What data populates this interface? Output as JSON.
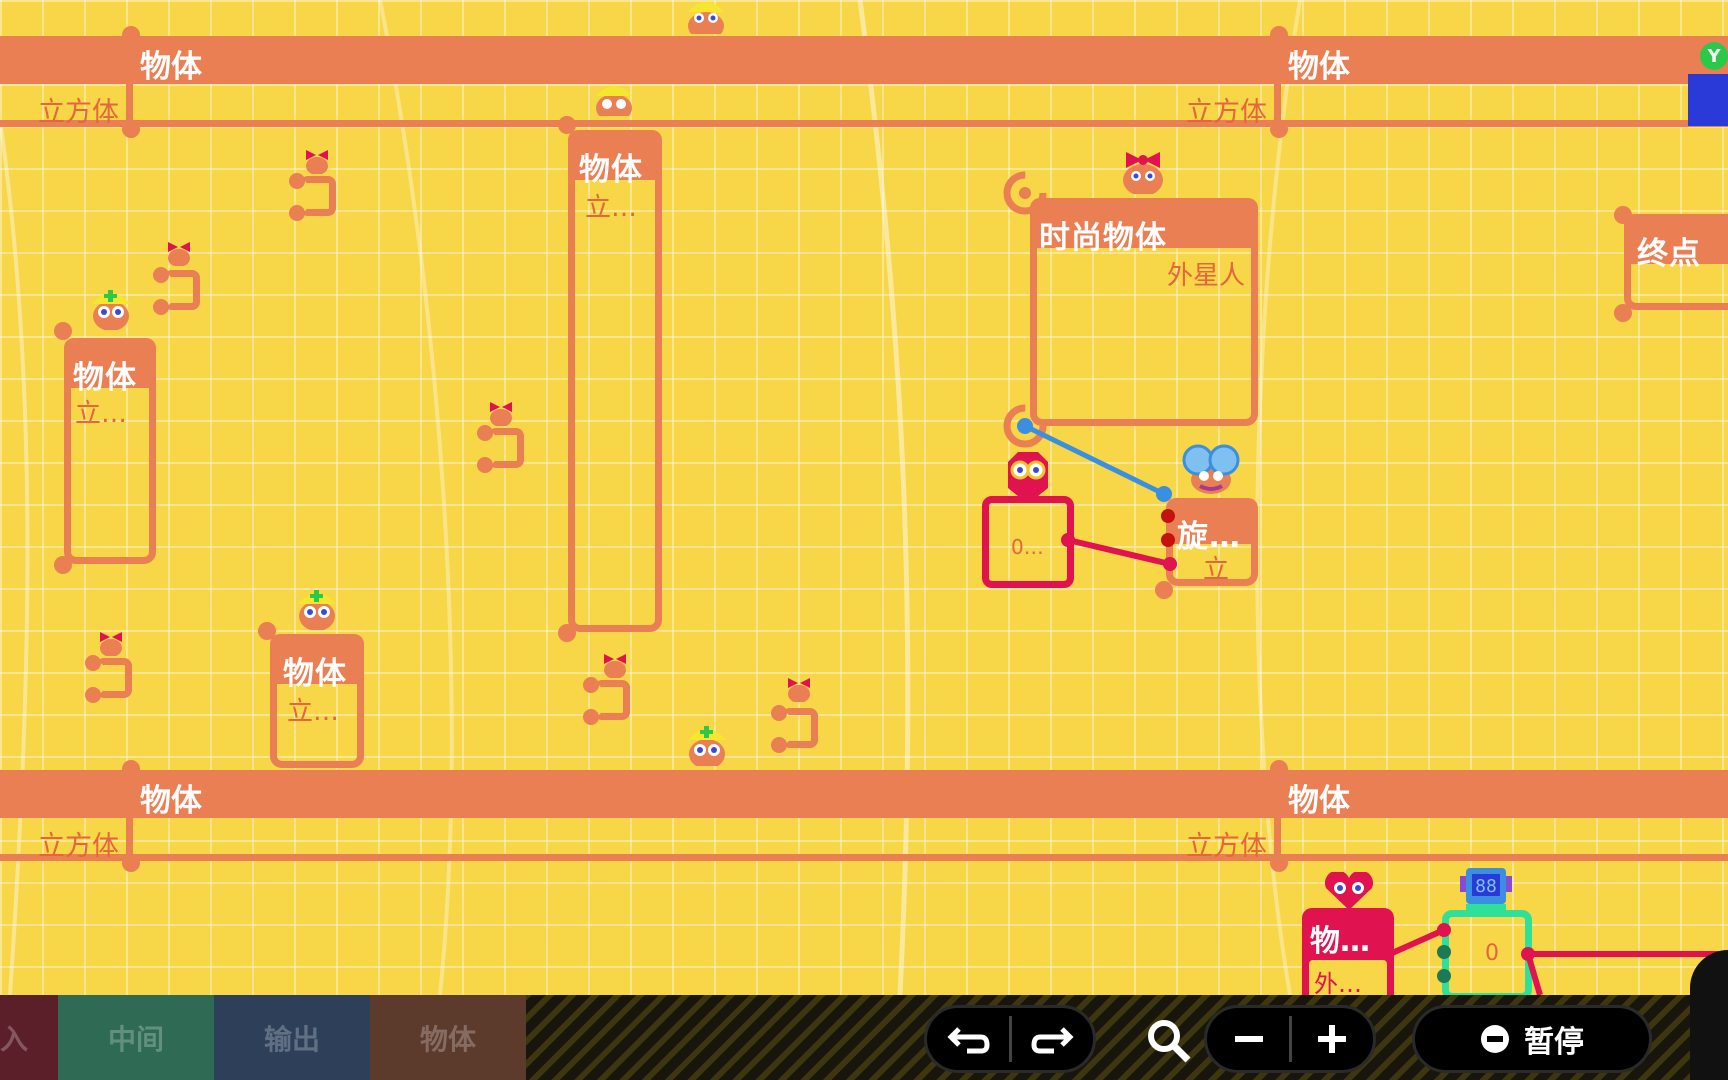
{
  "nodes": {
    "band_top_left_title": "物体",
    "band_top_left_sub": "立方体",
    "band_top_mid_sub": "立方体",
    "band_top_right_title": "物体",
    "band_bottom_left_title": "物体",
    "band_bottom_left_sub": "立方体",
    "band_bottom_mid_sub": "立方体",
    "band_bottom_right_title": "物体",
    "left_object_title": "物体",
    "left_object_sub": "立…",
    "tall_object_title": "物体",
    "tall_object_sub": "立…",
    "small_object_title": "物体",
    "small_object_sub": "立…",
    "fancy_object_title": "时尚物体",
    "fancy_object_sub": "外星人",
    "endpoint_title": "终点",
    "counter_value": "0…",
    "rotate_title": "旋…",
    "rotate_sub": "立",
    "alien_object_title": "物…",
    "alien_object_sub": "外…",
    "display_value": "0"
  },
  "toolbar": {
    "tabs": [
      {
        "label": "入",
        "color": "#5b1f2a"
      },
      {
        "label": "中间",
        "color": "#2f6a54"
      },
      {
        "label": "输出",
        "color": "#2d3f59"
      },
      {
        "label": "物体",
        "color": "#5c3a2c"
      }
    ],
    "pause_label": "暂停",
    "colors": {
      "wire_blue": "#3a8fe0",
      "wire_pink": "#e0128f",
      "node_orange": "#e97f53",
      "node_red": "#e0124f",
      "bg_yellow": "#f7d648"
    }
  },
  "icons": {
    "undo": "undo-icon",
    "redo": "redo-icon",
    "search": "search-icon",
    "zoom_out": "minus-icon",
    "zoom_in": "plus-icon",
    "pause": "minus-circle-icon",
    "y_button": "y-button-icon"
  },
  "y_badge": "Y"
}
